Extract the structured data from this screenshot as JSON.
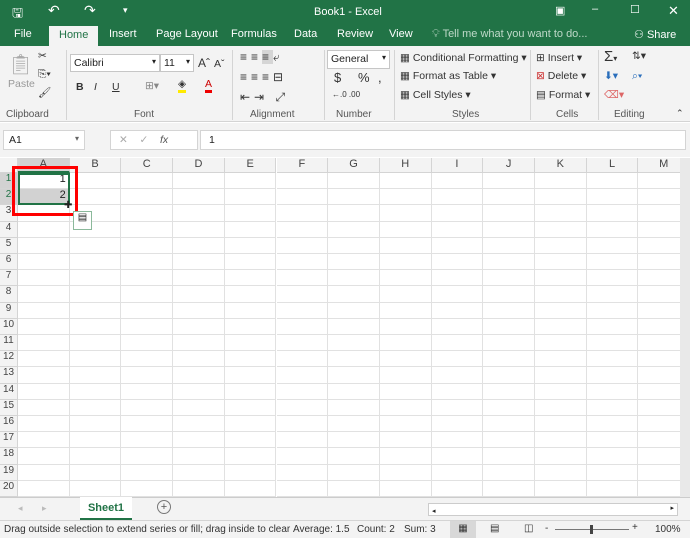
{
  "window": {
    "title": "Book1 - Excel"
  },
  "tabs": [
    "File",
    "Home",
    "Insert",
    "Page Layout",
    "Formulas",
    "Data",
    "Review",
    "View"
  ],
  "active_tab": "Home",
  "tell_me": "Tell me what you want to do...",
  "share": "Share",
  "ribbon": {
    "clipboard": {
      "label": "Clipboard",
      "paste": "Paste"
    },
    "font": {
      "label": "Font",
      "name": "Calibri",
      "size": "11",
      "bold": "B",
      "italic": "I",
      "underline": "U"
    },
    "alignment": {
      "label": "Alignment"
    },
    "number": {
      "label": "Number",
      "format": "General",
      "currency": "$",
      "percent": "%",
      "comma": ","
    },
    "styles": {
      "label": "Styles",
      "conditional": "Conditional Formatting",
      "format_table": "Format as Table",
      "cell_styles": "Cell Styles"
    },
    "cells": {
      "label": "Cells",
      "insert": "Insert",
      "delete": "Delete",
      "format": "Format"
    },
    "editing": {
      "label": "Editing"
    }
  },
  "formula_bar": {
    "name_box": "A1",
    "fx": "fx",
    "value": "1"
  },
  "columns": [
    "A",
    "B",
    "C",
    "D",
    "E",
    "F",
    "G",
    "H",
    "I",
    "J",
    "K",
    "L",
    "M"
  ],
  "rows": [
    "1",
    "2",
    "3",
    "4",
    "5",
    "6",
    "7",
    "8",
    "9",
    "10",
    "11",
    "12",
    "13",
    "14",
    "15",
    "16",
    "17",
    "18",
    "19",
    "20"
  ],
  "cells": {
    "A1": "1",
    "A2": "2"
  },
  "sheets": [
    "Sheet1"
  ],
  "status": {
    "message": "Drag outside selection to extend series or fill; drag inside to clear",
    "average": "Average: 1.5",
    "count": "Count: 2",
    "sum": "Sum: 3",
    "zoom": "100%"
  },
  "colors": {
    "accent": "#217346",
    "highlight": "#ff0000"
  }
}
